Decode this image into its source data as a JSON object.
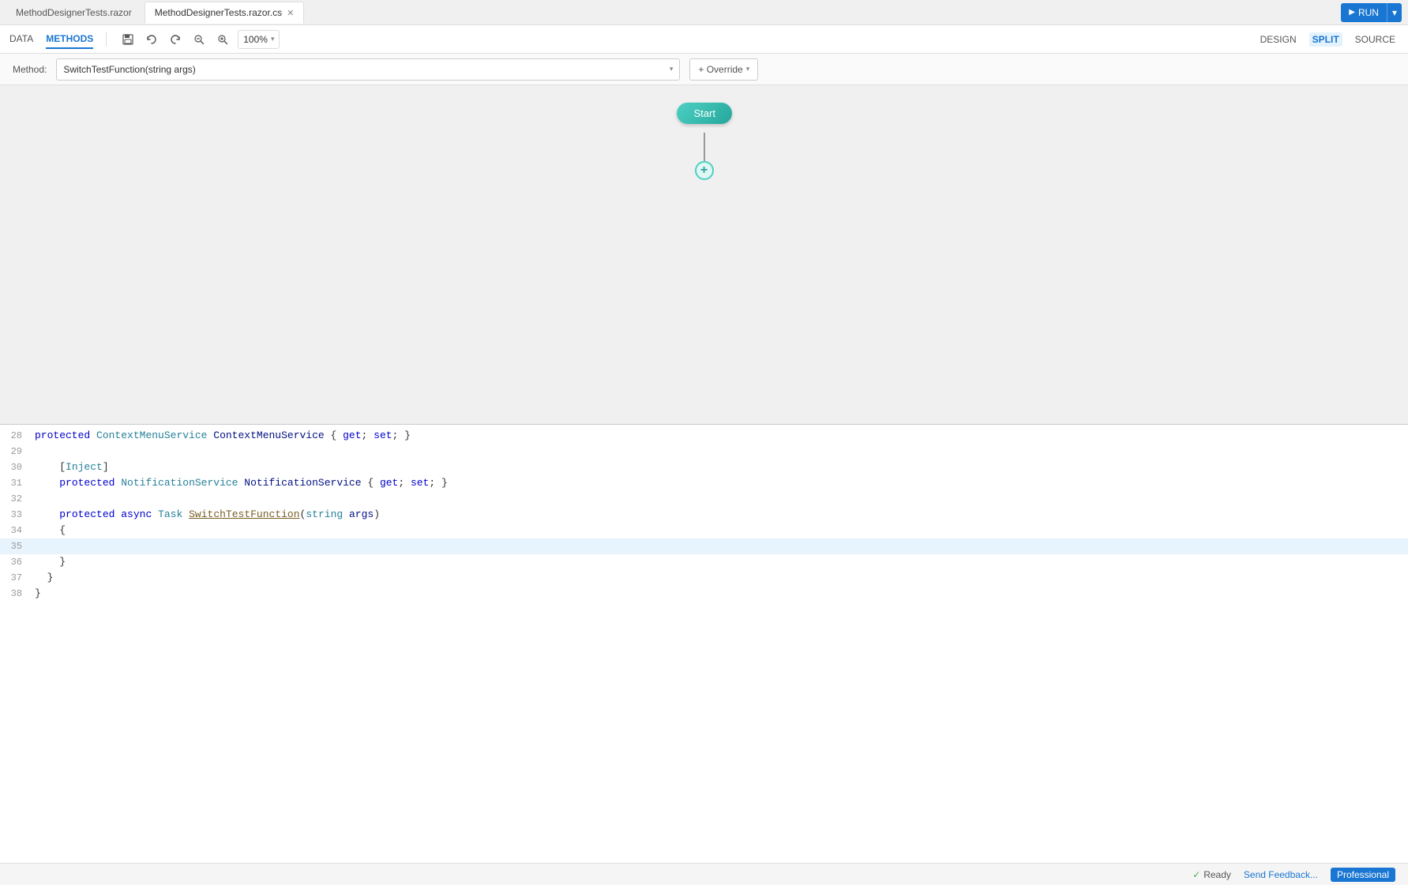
{
  "tabs": {
    "tab1": {
      "label": "MethodDesignerTests.razor",
      "active": false
    },
    "tab2": {
      "label": "MethodDesignerTests.razor.cs",
      "active": true
    },
    "run_button": "RUN"
  },
  "secondary_bar": {
    "nav_data": "DATA",
    "nav_methods": "METHODS",
    "toolbar": {
      "save_icon": "💾",
      "undo_icon": "↺",
      "redo_icon": "↻",
      "zoom_out_icon": "🔍",
      "zoom_in_icon": "🔍",
      "zoom_level": "100%"
    },
    "view_design": "DESIGN",
    "view_split": "SPLIT",
    "view_source": "SOURCE"
  },
  "method_bar": {
    "label": "Method:",
    "selected_method": "SwitchTestFunction(string args)",
    "override_label": "+ Override"
  },
  "designer": {
    "start_label": "Start",
    "add_button": "+"
  },
  "code": {
    "lines": [
      {
        "num": "28",
        "content": "    protected ContextMenuService ContextMenuService { get; set; }",
        "highlight": false
      },
      {
        "num": "29",
        "content": "",
        "highlight": false
      },
      {
        "num": "30",
        "content": "    [Inject]",
        "highlight": false
      },
      {
        "num": "31",
        "content": "    protected NotificationService NotificationService { get; set; }",
        "highlight": false
      },
      {
        "num": "32",
        "content": "",
        "highlight": false
      },
      {
        "num": "33",
        "content": "    protected async Task SwitchTestFunction(string args)",
        "highlight": false
      },
      {
        "num": "34",
        "content": "    {",
        "highlight": false
      },
      {
        "num": "35",
        "content": "",
        "highlight": true
      },
      {
        "num": "36",
        "content": "    }",
        "highlight": false
      },
      {
        "num": "37",
        "content": "  }",
        "highlight": false
      },
      {
        "num": "38",
        "content": "}",
        "highlight": false
      }
    ]
  },
  "status": {
    "ready_label": "Ready",
    "feedback_label": "Send Feedback...",
    "professional_label": "Professional"
  }
}
